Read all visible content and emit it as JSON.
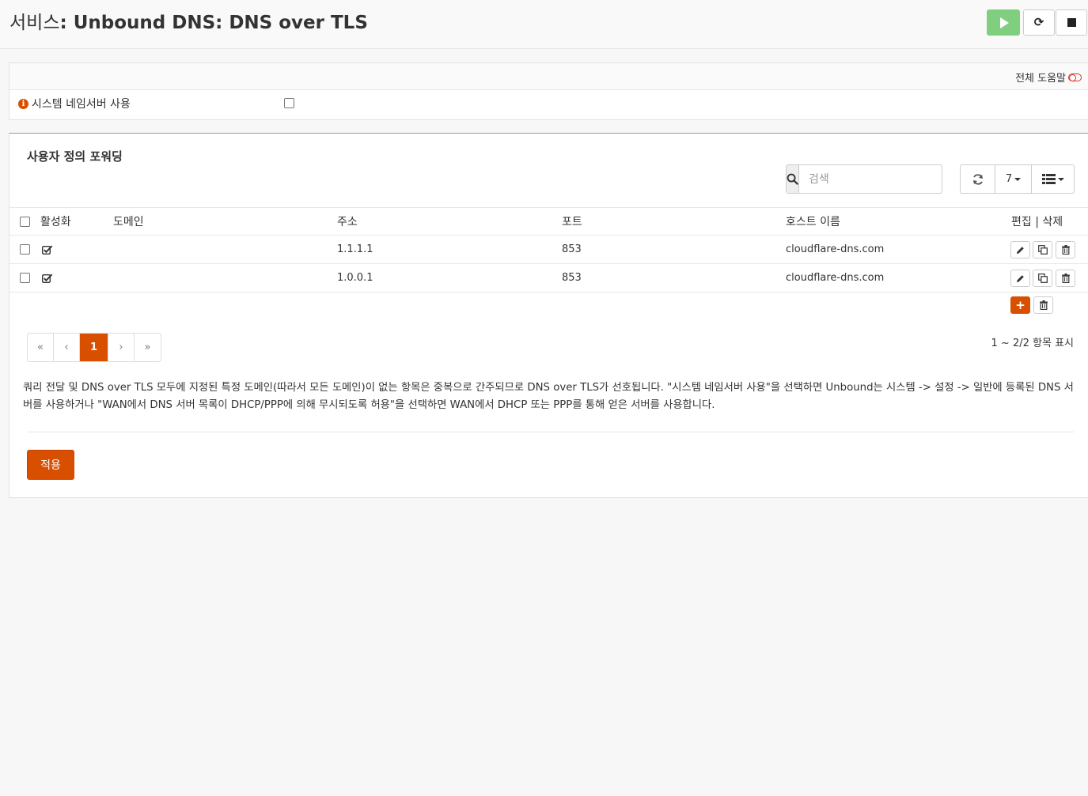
{
  "header": {
    "title_prefix": "서비스",
    "title_name": ": Unbound DNS: DNS over TLS"
  },
  "general": {
    "full_help": "전체 도움말",
    "system_nameservers_label": "시스템 네임서버 사용"
  },
  "forwarding": {
    "section_title": "사용자 정의 포워딩",
    "search_placeholder": "검색",
    "page_size": "7",
    "columns": {
      "enabled": "활성화",
      "domain": "도메인",
      "address": "주소",
      "port": "포트",
      "hostname": "호스트 이름",
      "commands": "편집 | 삭제"
    },
    "rows": [
      {
        "enabled": true,
        "domain": "",
        "address": "1.1.1.1",
        "port": "853",
        "hostname": "cloudflare-dns.com"
      },
      {
        "enabled": true,
        "domain": "",
        "address": "1.0.0.1",
        "port": "853",
        "hostname": "cloudflare-dns.com"
      }
    ],
    "pagination": {
      "first": "«",
      "prev": "‹",
      "current": "1",
      "next": "›",
      "last": "»"
    },
    "info": "1 ~ 2/2 항목 표시"
  },
  "help_text": "쿼리 전달 및 DNS over TLS 모두에 지정된 특정 도메인(따라서 모든 도메인)이 없는 항목은 중복으로 간주되므로 DNS over TLS가 선호됩니다. \"시스템 네임서버 사용\"을 선택하면 Unbound는 시스템 -> 설정 -> 일반에 등록된 DNS 서버를 사용하거나 \"WAN에서 DNS 서버 목록이 DHCP/PPP에 의해 무시되도록 허용\"을 선택하면 WAN에서 DHCP 또는 PPP를 통해 얻은 서버를 사용합니다.",
  "apply_label": "적용",
  "colors": {
    "accent": "#d94f00",
    "play": "#7fcf7f"
  }
}
